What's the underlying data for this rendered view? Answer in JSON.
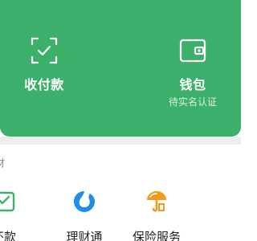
{
  "colors": {
    "green": "#3cb06a",
    "panel_text": "#ffffff",
    "panel_subtext": "#d8f0df",
    "section_bg": "#ededed",
    "tencent_blue": "#1e8fe8",
    "insurance_orange": "#f39a1e",
    "repay_green": "#3cb06a"
  },
  "top_panel": {
    "receive": {
      "icon": "scan-check-icon",
      "label": "收付款"
    },
    "wallet": {
      "icon": "wallet-icon",
      "label": "钱包",
      "sublabel": "待实名认证"
    }
  },
  "finance_section": {
    "title": "财",
    "items": [
      {
        "icon": "repay-icon",
        "label": "还款"
      },
      {
        "icon": "licaitong-icon",
        "label": "理财通"
      },
      {
        "icon": "insurance-icon",
        "label": "保险服务"
      }
    ]
  }
}
